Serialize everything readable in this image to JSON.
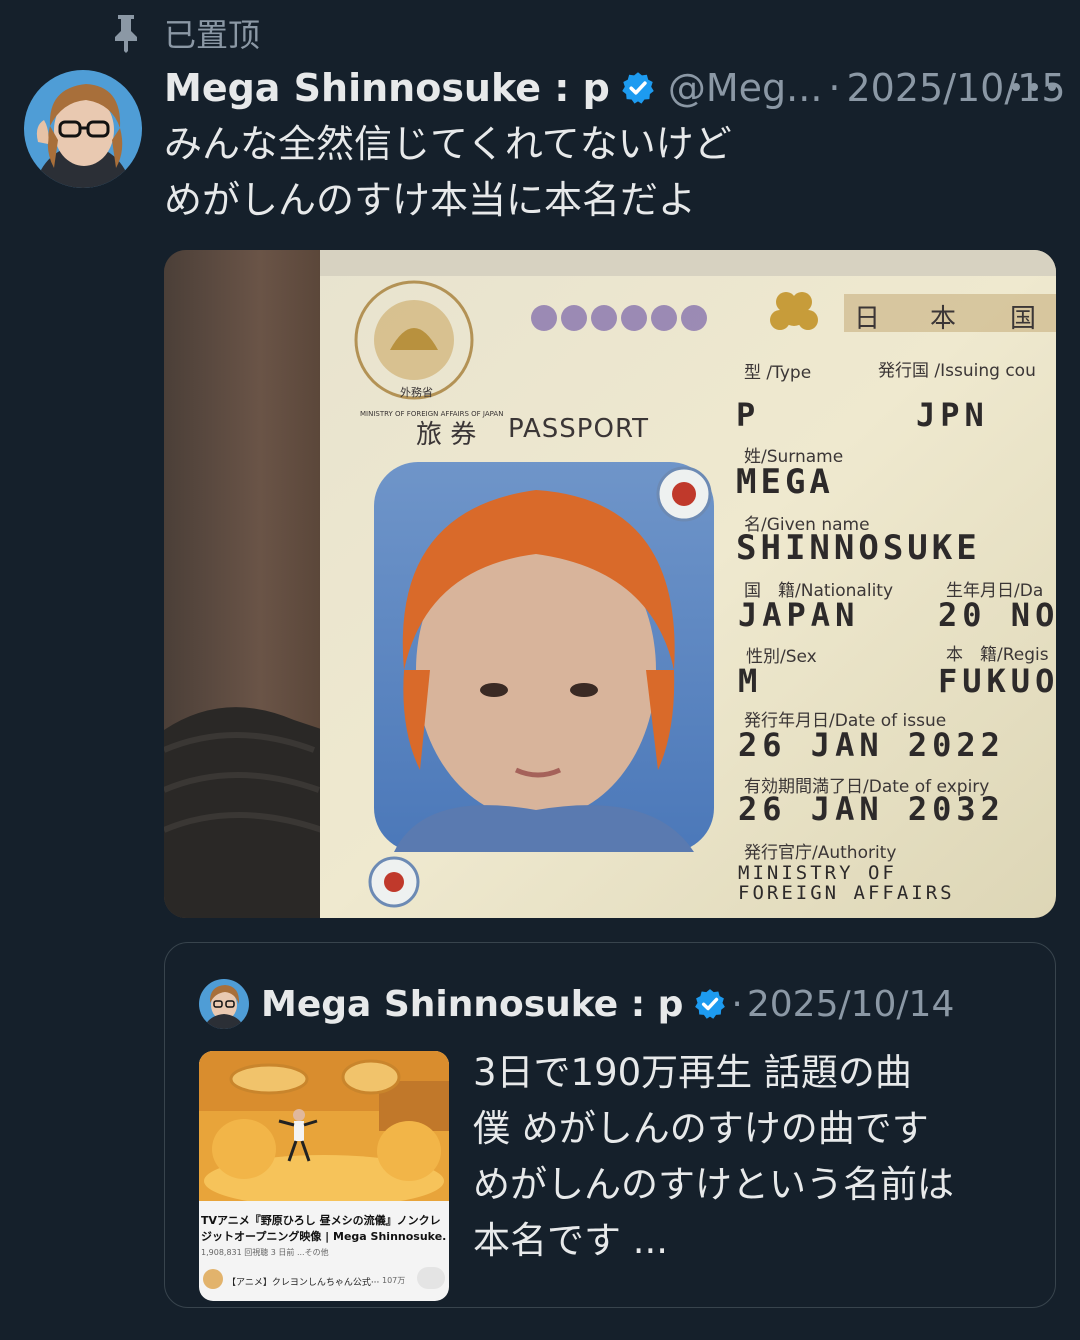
{
  "pinned": {
    "label": "已置顶"
  },
  "tweet": {
    "display_name": "Mega Shinnosuke : p",
    "handle": "@Meg...",
    "separator": "·",
    "date": "2025/10/15",
    "text_lines": [
      "みんな全然信じてくれてないけど",
      "めがしんのすけ本当に本名だよ"
    ]
  },
  "passport": {
    "header_chars": [
      "日",
      "本",
      "国"
    ],
    "seal_text": "MINISTRY OF FOREIGN AFFAIRS OF JAPAN",
    "seal_sub": "外務省",
    "title_jp": "旅 券",
    "title_en": "PASSPORT",
    "type_label": "型 /Type",
    "type_value": "P",
    "issuing_label": "発行国 /Issuing cou",
    "issuing_value": "JPN",
    "surname_label": "姓/Surname",
    "surname_value": "MEGA",
    "given_label": "名/Given name",
    "given_value": "SHINNOSUKE",
    "nationality_label": "国　籍/Nationality",
    "nationality_value": "JAPAN",
    "dob_label": "生年月日/Da",
    "dob_value": "20 NO",
    "sex_label": "性別/Sex",
    "sex_value": "M",
    "registered_label": "本　籍/Regis",
    "registered_value": "FUKUO",
    "issue_label": "発行年月日/Date of issue",
    "issue_value": "26 JAN 2022",
    "expiry_label": "有効期間満了日/Date of expiry",
    "expiry_value": "26 JAN 2032",
    "authority_label": "発行官庁/Authority",
    "authority_line1": "MINISTRY OF",
    "authority_line2": "FOREIGN AFFAIRS"
  },
  "quote": {
    "display_name": "Mega Shinnosuke : p",
    "separator": "·",
    "date": "2025/10/14",
    "text_lines": [
      "3日で190万再生 話題の曲",
      "僕 めがしんのすけの曲です",
      "めがしんのすけという名前は",
      "本名です ..."
    ],
    "video": {
      "title_line1": "TVアニメ『野原ひろし 昼メシの流儀』ノンクレ",
      "title_line2": "ジットオープニング映像 | Mega Shinnosuke...",
      "meta": "1,908,831 回視聴  3 日前  ...その他",
      "channel": "【アニメ】クレヨンしんちゃん公式···",
      "subscribers": "107万"
    }
  },
  "colors": {
    "background": "#15202b",
    "text_primary": "#e7e9ea",
    "text_secondary": "#8b98a5",
    "verified": "#1d9bf0",
    "border": "#38444d"
  },
  "icons": {
    "pin": "pin-icon",
    "verified": "verified-badge-icon",
    "more": "more-dots-icon"
  }
}
